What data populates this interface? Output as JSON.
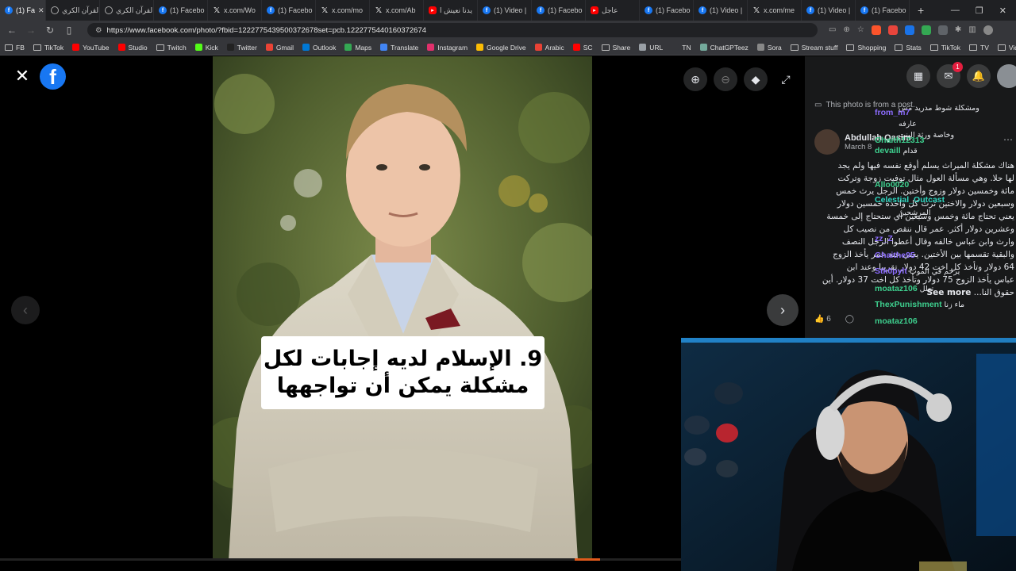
{
  "tabs": [
    {
      "label": "(1) Fa",
      "icon": "facebook-icon",
      "active": true
    },
    {
      "label": "القرآن الكري",
      "icon": "globe-icon"
    },
    {
      "label": "القرآن الكري",
      "icon": "globe-icon"
    },
    {
      "label": "(1) Facebo",
      "icon": "facebook-icon"
    },
    {
      "label": "x.com/Wo",
      "icon": "x-icon"
    },
    {
      "label": "(1) Facebo",
      "icon": "facebook-icon"
    },
    {
      "label": "x.com/mo",
      "icon": "x-icon"
    },
    {
      "label": "x.com/Ab",
      "icon": "x-icon"
    },
    {
      "label": "يدنا نعيش ا",
      "icon": "youtube-icon"
    },
    {
      "label": "(1) Video |",
      "icon": "facebook-icon"
    },
    {
      "label": "(1) Facebo",
      "icon": "facebook-icon"
    },
    {
      "label": "عاجل",
      "icon": "youtube-icon"
    },
    {
      "label": "(1) Facebo",
      "icon": "facebook-icon"
    },
    {
      "label": "(1) Video |",
      "icon": "facebook-icon"
    },
    {
      "label": "x.com/me",
      "icon": "x-icon"
    },
    {
      "label": "(1) Video |",
      "icon": "facebook-icon"
    },
    {
      "label": "(1) Facebo",
      "icon": "facebook-icon"
    }
  ],
  "new_tab": "+",
  "window_controls": {
    "minimize": "—",
    "restore": "❐",
    "close": "✕"
  },
  "address": {
    "url": "https://www.facebook.com/photo/?fbid=1222775439500372678set=pcb.1222775440160372674"
  },
  "bookmarks": [
    {
      "label": "FB",
      "icon": "folder-icon"
    },
    {
      "label": "TikTok",
      "icon": "folder-icon"
    },
    {
      "label": "YouTube",
      "icon": "youtube-icon",
      "color": "#ff0000"
    },
    {
      "label": "Studio",
      "icon": "youtube-studio-icon",
      "color": "#ff0000"
    },
    {
      "label": "Twitch",
      "icon": "folder-icon"
    },
    {
      "label": "Kick",
      "icon": "kick-icon",
      "color": "#53fc18"
    },
    {
      "label": "Twitter",
      "icon": "x-icon",
      "color": "#222222"
    },
    {
      "label": "Gmail",
      "icon": "gmail-icon",
      "color": "#ea4335"
    },
    {
      "label": "Outlook",
      "icon": "outlook-icon",
      "color": "#0078d4"
    },
    {
      "label": "Maps",
      "icon": "maps-icon",
      "color": "#34a853"
    },
    {
      "label": "Translate",
      "icon": "translate-icon",
      "color": "#4285f4"
    },
    {
      "label": "Instagram",
      "icon": "instagram-icon",
      "color": "#e1306c"
    },
    {
      "label": "Google Drive",
      "icon": "drive-icon",
      "color": "#fbbc04"
    },
    {
      "label": "Arabic",
      "icon": "arabic-icon",
      "color": "#e94235"
    },
    {
      "label": "SC",
      "icon": "sc-icon",
      "color": "#ff0000"
    },
    {
      "label": "Share",
      "icon": "folder-icon"
    },
    {
      "label": "URL",
      "icon": "url-icon",
      "color": "#9aa0a6"
    },
    {
      "label": "TN",
      "icon": "tn-icon",
      "color": "#35363a"
    },
    {
      "label": "ChatGPTeez",
      "icon": "chatgpt-icon",
      "color": "#74aa9c"
    },
    {
      "label": "Sora",
      "icon": "sora-icon",
      "color": "#888888"
    },
    {
      "label": "Stream stuff",
      "icon": "folder-icon"
    },
    {
      "label": "Shopping",
      "icon": "folder-icon"
    },
    {
      "label": "Stats",
      "icon": "folder-icon"
    },
    {
      "label": "TikTok",
      "icon": "folder-icon"
    },
    {
      "label": "TV",
      "icon": "folder-icon"
    },
    {
      "label": "Vids",
      "icon": "folder-icon"
    }
  ],
  "viewer": {
    "caption_line1": "9. الإسلام لديه إجابات لكل",
    "caption_line2": "مشكلة يمكن أن تواجهها"
  },
  "panel": {
    "messenger_badge": "1",
    "from_post": "This photo is from a post.",
    "author_name": "Abdullah Qasim",
    "author_date": "March 8",
    "post_lines": [
      "هناك مشكلة الميراث يسلم أوقع نفسه فيها ولم يجد",
      "لها حلا. وهي مسألة العول مثال توفيت زوجة وتركت",
      "مائة وخمسين دولار وزوج وأختين. الرجل يرث خمس",
      "وسبعين دولار والاختين ترث كل واحدة خمسين دولار",
      "يعني تحتاج مائة وخمس وسبعين أي ستحتاج إلى خمسة",
      "وعشرين دولار أكثر. عمر قال ننقص من نصيب كل",
      "وارث وابن عباس خالفه وقال أعطوا الرجل النصف",
      "والبقية تقسمها بين الأختين. يعني عند عمر يأخذ الزوج",
      "64 دولار وتأخذ كل اخت 42 دولار تقريبا وعند ابن",
      "عباس يأخذ الزوج 75 دولار وتأخذ كل اخت 37 دولار. أين"
    ],
    "post_last_line": "حقوق النا...",
    "see_more": "See more",
    "like_count": "6"
  },
  "chat": [
    {
      "user": "",
      "msg": "ومشكلة شوط مدريد مش",
      "color": "#e4e6eb"
    },
    {
      "user": "from_m7",
      "msg": "",
      "color": "#8c6cff"
    },
    {
      "user": "",
      "msg": "عارفه",
      "color": "#e4e6eb"
    },
    {
      "user": "",
      "msg": "وخاصة ورثة البنت",
      "color": "#e4e6eb"
    },
    {
      "user": "Ghaith12313",
      "msg": "",
      "color": "#3ecf8e"
    },
    {
      "user": "devaill",
      "msg": "قدام",
      "color": "#3ecf8e"
    },
    {
      "user": "Allo0020",
      "msg": "",
      "color": "#3ecf8e"
    },
    {
      "user": "Celestial_Outcast",
      "msg": "",
      "color": "#2fd6c0"
    },
    {
      "user": "",
      "msg": "المرشحين",
      "color": "#e4e6eb"
    },
    {
      "user": "zz_Z",
      "msg": "",
      "color": "#8c6cff"
    },
    {
      "user": "Ghaithe95",
      "msg": "",
      "color": "#8c6cff"
    },
    {
      "user": "Stk0pylt",
      "msg": "يرحم في الموت",
      "color": "#8c6cff"
    },
    {
      "user": "moataz106",
      "msg": "تعلل",
      "color": "#3ecf8e"
    },
    {
      "user": "ThexPunishment",
      "msg": "ماء زنا",
      "color": "#3ecf8e"
    },
    {
      "user": "moataz106",
      "msg": "",
      "color": "#3ecf8e"
    }
  ]
}
